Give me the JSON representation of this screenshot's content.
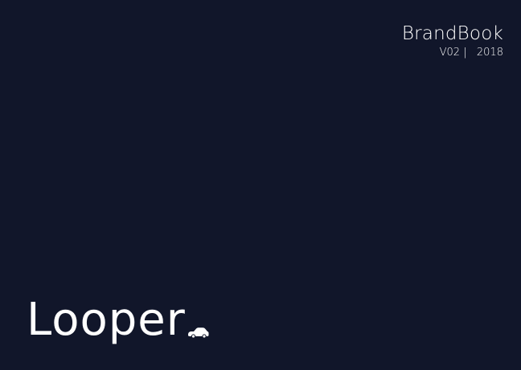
{
  "document": {
    "title": "BrandBook",
    "version_line": "V02 |   2018"
  },
  "logo": {
    "wordmark": "Looper",
    "icon": "car-icon"
  },
  "colors": {
    "background": "#11162a",
    "text": "#ffffff"
  }
}
